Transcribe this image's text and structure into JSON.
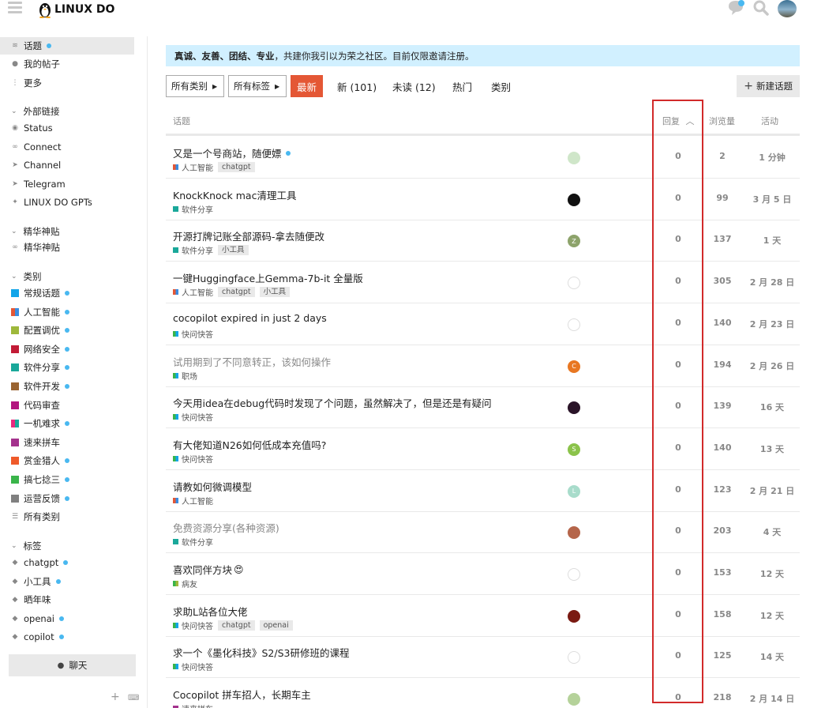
{
  "header": {
    "logo_text": "LINUX DO",
    "icons": [
      "hamburger-icon",
      "chat-icon",
      "search-icon",
      "user-avatar"
    ]
  },
  "sidebar": {
    "top_items": [
      {
        "label": "话题",
        "icon": "layers-icon",
        "active": true,
        "dot": true
      },
      {
        "label": "我的帖子",
        "icon": "user-icon",
        "active": false,
        "dot": false
      },
      {
        "label": "更多",
        "icon": "ellipsis-icon",
        "active": false,
        "dot": false
      }
    ],
    "external_heading": "外部链接",
    "external_links": [
      {
        "label": "Status",
        "icon": "eye-icon"
      },
      {
        "label": "Connect",
        "icon": "link-icon"
      },
      {
        "label": "Channel",
        "icon": "send-icon"
      },
      {
        "label": "Telegram",
        "icon": "send-icon"
      },
      {
        "label": "LINUX DO GPTs",
        "icon": "sparkle-icon"
      }
    ],
    "featured_heading": "精华神贴",
    "featured_links": [
      {
        "label": "精华神贴",
        "icon": "link-icon"
      }
    ],
    "categories_heading": "类别",
    "categories": [
      {
        "label": "常规话题",
        "color": "#12a5e9",
        "color2": "#12a5e9",
        "dot": true
      },
      {
        "label": "人工智能",
        "color": "#e45735",
        "color2": "#3a8de0",
        "dot": true
      },
      {
        "label": "配置调优",
        "color": "#9eb83b",
        "color2": "#9eb83b",
        "dot": true
      },
      {
        "label": "网络安全",
        "color": "#c21b36",
        "color2": "#c21b36",
        "dot": true
      },
      {
        "label": "软件分享",
        "color": "#1aa89a",
        "color2": "#1aa89a",
        "dot": true
      },
      {
        "label": "软件开发",
        "color": "#9a6432",
        "color2": "#9a6432",
        "dot": true
      },
      {
        "label": "代码审查",
        "color": "#b3157f",
        "color2": "#b3157f",
        "dot": false
      },
      {
        "label": "一机难求",
        "color": "#e92a7f",
        "color2": "#1aa89a",
        "dot": true
      },
      {
        "label": "速来拼车",
        "color": "#a4328d",
        "color2": "#a4328d",
        "dot": false
      },
      {
        "label": "赏金猎人",
        "color": "#ef5a2a",
        "color2": "#ef5a2a",
        "dot": true
      },
      {
        "label": "搞七捻三",
        "color": "#3ab54a",
        "color2": "#3ab54a",
        "dot": true
      },
      {
        "label": "运营反馈",
        "color": "#808080",
        "color2": "#808080",
        "dot": true
      },
      {
        "label": "所有类别",
        "color": "",
        "color2": "",
        "dot": false
      }
    ],
    "tags_heading": "标签",
    "tags": [
      {
        "label": "chatgpt",
        "dot": true
      },
      {
        "label": "小工具",
        "dot": true
      },
      {
        "label": "晒年味",
        "dot": false
      },
      {
        "label": "openai",
        "dot": true
      },
      {
        "label": "copilot",
        "dot": true
      }
    ],
    "chat_button": "聊天"
  },
  "banner": {
    "bold_text": "真诚、友善、团结、专业",
    "rest_text": "，共建你我引以为荣之社区。目前仅限邀请注册。"
  },
  "nav": {
    "category_dropdown": "所有类别",
    "tag_dropdown": "所有标签",
    "latest": "最新",
    "new": "新 (101)",
    "unread": "未读 (12)",
    "hot": "热门",
    "categories": "类别",
    "new_topic": "新建话题"
  },
  "table": {
    "col_topic": "话题",
    "col_replies": "回复",
    "col_views": "浏览量",
    "col_activity": "活动",
    "rows": [
      {
        "title": "又是一个号商站，随便嫖",
        "read": false,
        "unread_dot": true,
        "emoji": false,
        "category": "人工智能",
        "cat_color": "#e45735",
        "cat_color2": "#3a8de0",
        "tags": [
          "chatgpt"
        ],
        "avatar_color": "#cfe6c9",
        "avatar_letter": "",
        "replies": "0",
        "views": "2",
        "activity": "1 分钟"
      },
      {
        "title": "KnockKnock mac清理工具",
        "read": false,
        "unread_dot": false,
        "emoji": false,
        "category": "软件分享",
        "cat_color": "#1aa89a",
        "cat_color2": "#1aa89a",
        "tags": [],
        "avatar_color": "#111111",
        "avatar_letter": "",
        "replies": "0",
        "views": "99",
        "activity": "3 月 5 日"
      },
      {
        "title": "开源打牌记账全部源码-拿去随便改",
        "read": false,
        "unread_dot": false,
        "emoji": false,
        "category": "软件分享",
        "cat_color": "#1aa89a",
        "cat_color2": "#1aa89a",
        "tags": [
          "小工具"
        ],
        "avatar_color": "#8da36b",
        "avatar_letter": "Z",
        "replies": "0",
        "views": "137",
        "activity": "1 天"
      },
      {
        "title": "一键Huggingface上Gemma-7b-it 全量版",
        "read": false,
        "unread_dot": false,
        "emoji": false,
        "category": "人工智能",
        "cat_color": "#e45735",
        "cat_color2": "#3a8de0",
        "tags": [
          "chatgpt",
          "小工具"
        ],
        "avatar_color": "#ffffff",
        "avatar_letter": "",
        "replies": "0",
        "views": "305",
        "activity": "2 月 28 日"
      },
      {
        "title": "cocopilot expired in just 2 days",
        "read": false,
        "unread_dot": false,
        "emoji": false,
        "category": "快问快答",
        "cat_color": "#3ab54a",
        "cat_color2": "#12a5e9",
        "tags": [],
        "avatar_color": "#ffffff",
        "avatar_letter": "",
        "replies": "0",
        "views": "140",
        "activity": "2 月 23 日"
      },
      {
        "title": "试用期到了不同意转正，该如何操作",
        "read": true,
        "unread_dot": false,
        "emoji": false,
        "category": "职场",
        "cat_color": "#3ab54a",
        "cat_color2": "#12a5e9",
        "tags": [],
        "avatar_color": "#e87722",
        "avatar_letter": "C",
        "replies": "0",
        "views": "194",
        "activity": "2 月 26 日"
      },
      {
        "title": "今天用idea在debug代码时发现了个问题，虽然解决了，但是还是有疑问",
        "read": false,
        "unread_dot": false,
        "emoji": false,
        "category": "快问快答",
        "cat_color": "#3ab54a",
        "cat_color2": "#12a5e9",
        "tags": [],
        "avatar_color": "#2a1428",
        "avatar_letter": "",
        "replies": "0",
        "views": "139",
        "activity": "16 天"
      },
      {
        "title": "有大佬知道N26如何低成本充值吗?",
        "read": false,
        "unread_dot": false,
        "emoji": false,
        "category": "快问快答",
        "cat_color": "#3ab54a",
        "cat_color2": "#12a5e9",
        "tags": [],
        "avatar_color": "#8bc34a",
        "avatar_letter": "S",
        "replies": "0",
        "views": "140",
        "activity": "13 天"
      },
      {
        "title": "请教如何微调模型",
        "read": false,
        "unread_dot": false,
        "emoji": false,
        "category": "人工智能",
        "cat_color": "#e45735",
        "cat_color2": "#3a8de0",
        "tags": [],
        "avatar_color": "#a8dccb",
        "avatar_letter": "L",
        "replies": "0",
        "views": "123",
        "activity": "2 月 21 日"
      },
      {
        "title": "免费资源分享(各种资源)",
        "read": true,
        "unread_dot": false,
        "emoji": false,
        "category": "软件分享",
        "cat_color": "#1aa89a",
        "cat_color2": "#1aa89a",
        "tags": [],
        "avatar_color": "#b5654a",
        "avatar_letter": "",
        "replies": "0",
        "views": "203",
        "activity": "4 天"
      },
      {
        "title": "喜欢同伴方块",
        "read": false,
        "unread_dot": false,
        "emoji": true,
        "category": "病友",
        "cat_color": "#3ab54a",
        "cat_color2": "#9eb83b",
        "tags": [],
        "avatar_color": "#ffffff",
        "avatar_letter": "",
        "replies": "0",
        "views": "153",
        "activity": "12 天"
      },
      {
        "title": "求助L站各位大佬",
        "read": false,
        "unread_dot": false,
        "emoji": false,
        "category": "快问快答",
        "cat_color": "#3ab54a",
        "cat_color2": "#12a5e9",
        "tags": [
          "chatgpt",
          "openai"
        ],
        "avatar_color": "#7a1a12",
        "avatar_letter": "",
        "replies": "0",
        "views": "158",
        "activity": "12 天"
      },
      {
        "title": "求一个《墨化科技》S2/S3研修班的课程",
        "read": false,
        "unread_dot": false,
        "emoji": false,
        "category": "快问快答",
        "cat_color": "#3ab54a",
        "cat_color2": "#12a5e9",
        "tags": [],
        "avatar_color": "#ffffff",
        "avatar_letter": "",
        "replies": "0",
        "views": "125",
        "activity": "14 天"
      },
      {
        "title": "Cocopilot 拼车招人，长期车主",
        "read": false,
        "unread_dot": false,
        "emoji": false,
        "category": "速来拼车",
        "cat_color": "#a4328d",
        "cat_color2": "#a4328d",
        "tags": [],
        "avatar_color": "#b5d29a",
        "avatar_letter": "",
        "replies": "0",
        "views": "218",
        "activity": "2 月 14 日"
      }
    ]
  },
  "colors": {
    "accent": "#e45735",
    "banner_bg": "#d1f0ff",
    "unread_dot": "#49b8f0",
    "highlight_box": "#d22a2a"
  }
}
